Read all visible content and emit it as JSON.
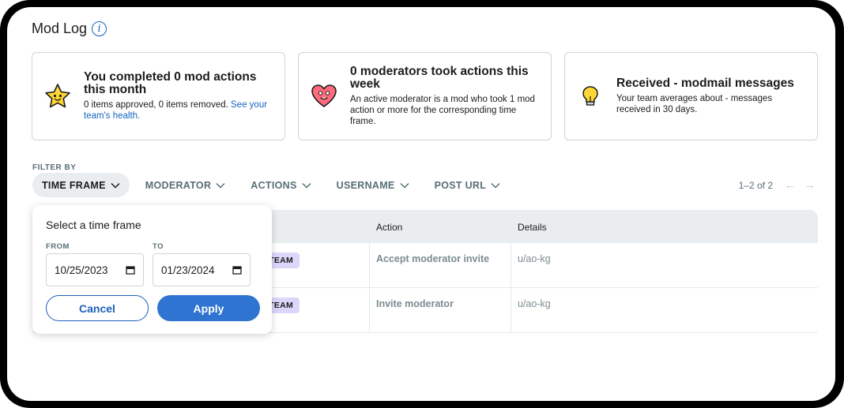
{
  "page": {
    "title": "Mod Log"
  },
  "cards": [
    {
      "icon": "star-icon",
      "title": "You completed 0 mod actions this month",
      "text": "0 items approved, 0 items removed.",
      "link": "See your team's health."
    },
    {
      "icon": "heart-icon",
      "title": "0 moderators took actions this week",
      "text": "An active moderator is a mod who took 1 mod action or more for the corresponding time frame."
    },
    {
      "icon": "lightbulb-icon",
      "title": "Received - modmail messages",
      "text": "Your team averages about - messages received in 30 days."
    }
  ],
  "filters": {
    "label": "FILTER BY",
    "items": [
      "TIME FRAME",
      "MODERATOR",
      "ACTIONS",
      "USERNAME",
      "POST URL"
    ],
    "active": "TIME FRAME"
  },
  "pager": {
    "text": "1–2 of 2"
  },
  "table": {
    "headers": {
      "action": "Action",
      "details": "Details"
    },
    "rows": [
      {
        "badge": "D TEAM",
        "action": "Accept moderator invite",
        "details": "u/ao-kg"
      },
      {
        "badge": "D TEAM",
        "action": "Invite moderator",
        "details": "u/ao-kg"
      }
    ]
  },
  "time_frame_popover": {
    "title": "Select a time frame",
    "from_label": "FROM",
    "to_label": "TO",
    "from_value": "10/25/2023",
    "to_value": "01/23/2024",
    "cancel_label": "Cancel",
    "apply_label": "Apply"
  },
  "colors": {
    "accent": "#2f74d0",
    "link": "#1565c0",
    "badge": "#dcd6fb"
  }
}
